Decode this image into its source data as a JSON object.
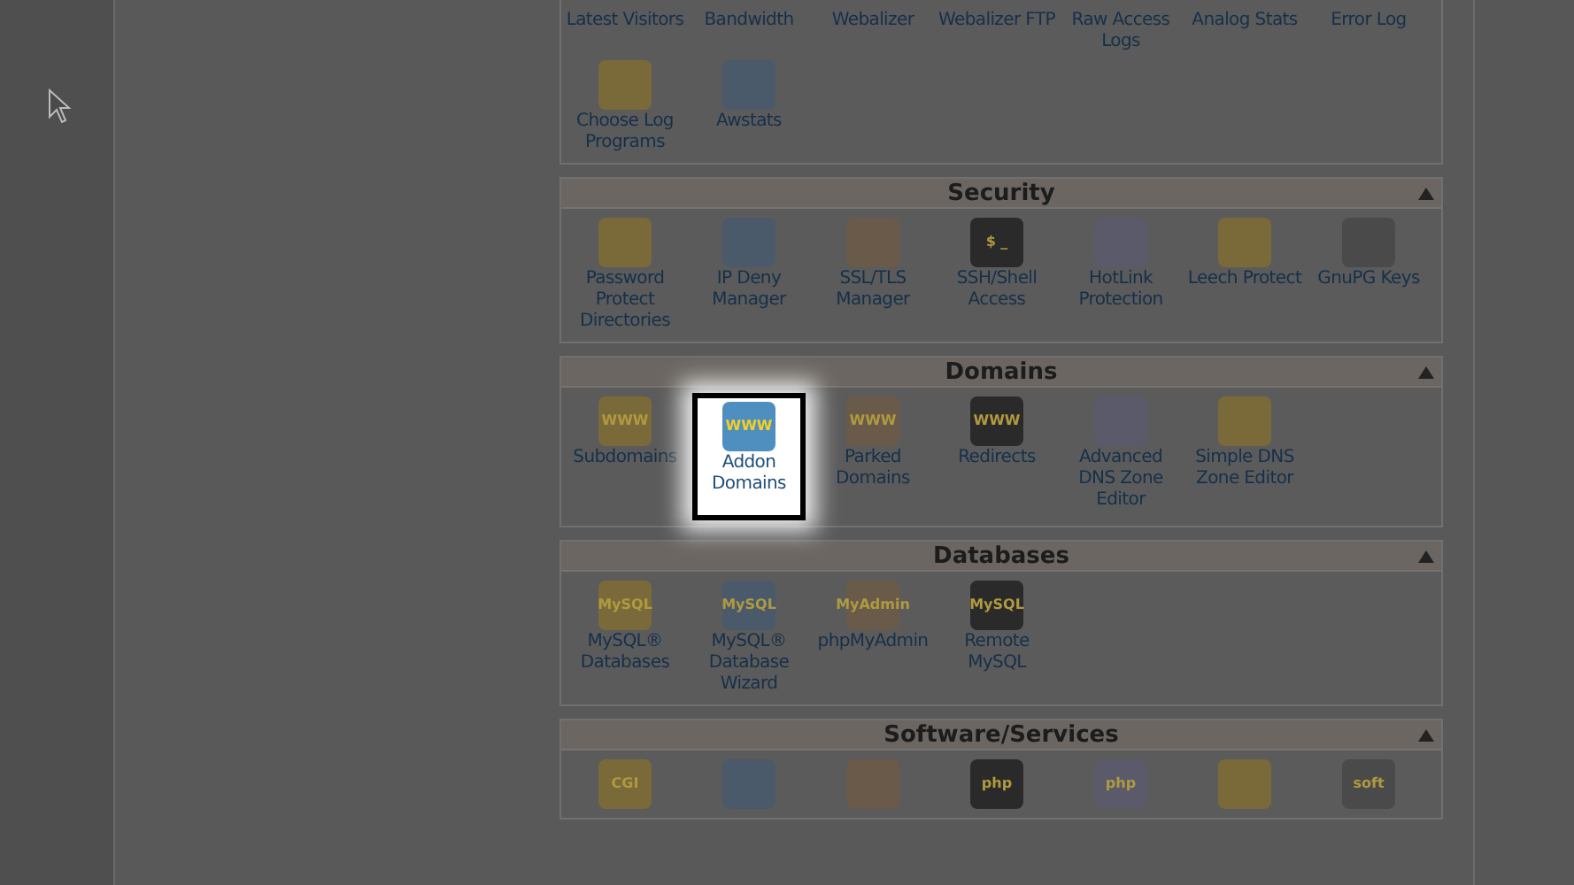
{
  "sections": [
    {
      "items": [
        {
          "kind": "caption",
          "label": "Latest Visitors",
          "selected": false
        },
        {
          "kind": "caption",
          "label": "Bandwidth",
          "selected": false
        },
        {
          "kind": "caption",
          "label": "Webalizer",
          "selected": false
        },
        {
          "kind": "caption",
          "label": "Webalizer FTP",
          "selected": false
        },
        {
          "kind": "caption",
          "label": "Raw Access Logs",
          "selected": false
        },
        {
          "kind": "caption",
          "label": "Analog Stats",
          "selected": false
        },
        {
          "kind": "caption",
          "label": "Error Log",
          "selected": false
        },
        {
          "kind": "tool",
          "label": "Choose Log Programs",
          "selected": false
        },
        {
          "kind": "tool",
          "label": "Awstats",
          "selected": false
        }
      ]
    },
    {
      "title": "Security",
      "items": [
        {
          "kind": "tool",
          "label": "Password Protect Directories",
          "selected": false
        },
        {
          "kind": "tool",
          "label": "IP Deny Manager",
          "selected": false
        },
        {
          "kind": "tool",
          "label": "SSL/TLS Manager",
          "selected": false
        },
        {
          "kind": "tool",
          "label": "SSH/Shell Access",
          "selected": false,
          "icon_text": "$ _"
        },
        {
          "kind": "tool",
          "label": "HotLink Protection",
          "selected": false
        },
        {
          "kind": "tool",
          "label": "Leech Protect",
          "selected": false
        },
        {
          "kind": "tool",
          "label": "GnuPG Keys",
          "selected": false
        }
      ]
    },
    {
      "title": "Domains",
      "items": [
        {
          "kind": "tool",
          "label": "Subdomains",
          "selected": false,
          "icon_text": "WWW"
        },
        {
          "kind": "tool",
          "label": "Addon Domains",
          "selected": true,
          "icon_text": "WWW"
        },
        {
          "kind": "tool",
          "label": "Parked Domains",
          "selected": false,
          "icon_text": "WWW"
        },
        {
          "kind": "tool",
          "label": "Redirects",
          "selected": false,
          "icon_text": "WWW"
        },
        {
          "kind": "tool",
          "label": "Advanced DNS Zone Editor",
          "selected": false
        },
        {
          "kind": "tool",
          "label": "Simple DNS Zone Editor",
          "selected": false
        }
      ]
    },
    {
      "title": "Databases",
      "items": [
        {
          "kind": "tool",
          "label": "MySQL® Databases",
          "selected": false,
          "icon_text": "MySQL"
        },
        {
          "kind": "tool",
          "label": "MySQL® Database Wizard",
          "selected": false,
          "icon_text": "MySQL"
        },
        {
          "kind": "tool",
          "label": "phpMyAdmin",
          "selected": false,
          "icon_text": "MyAdmin"
        },
        {
          "kind": "tool",
          "label": "Remote MySQL",
          "selected": false,
          "icon_text": "MySQL"
        }
      ]
    },
    {
      "title": "Software/Services",
      "items": [
        {
          "kind": "tool",
          "selected": false,
          "icon_text": "CGI"
        },
        {
          "kind": "tool",
          "selected": false
        },
        {
          "kind": "tool",
          "selected": false
        },
        {
          "kind": "tool",
          "selected": false,
          "icon_text": "php"
        },
        {
          "kind": "tool",
          "selected": false,
          "icon_text": "php"
        },
        {
          "kind": "tool",
          "selected": false
        },
        {
          "kind": "tool",
          "selected": false,
          "icon_text": "soft"
        }
      ]
    }
  ]
}
